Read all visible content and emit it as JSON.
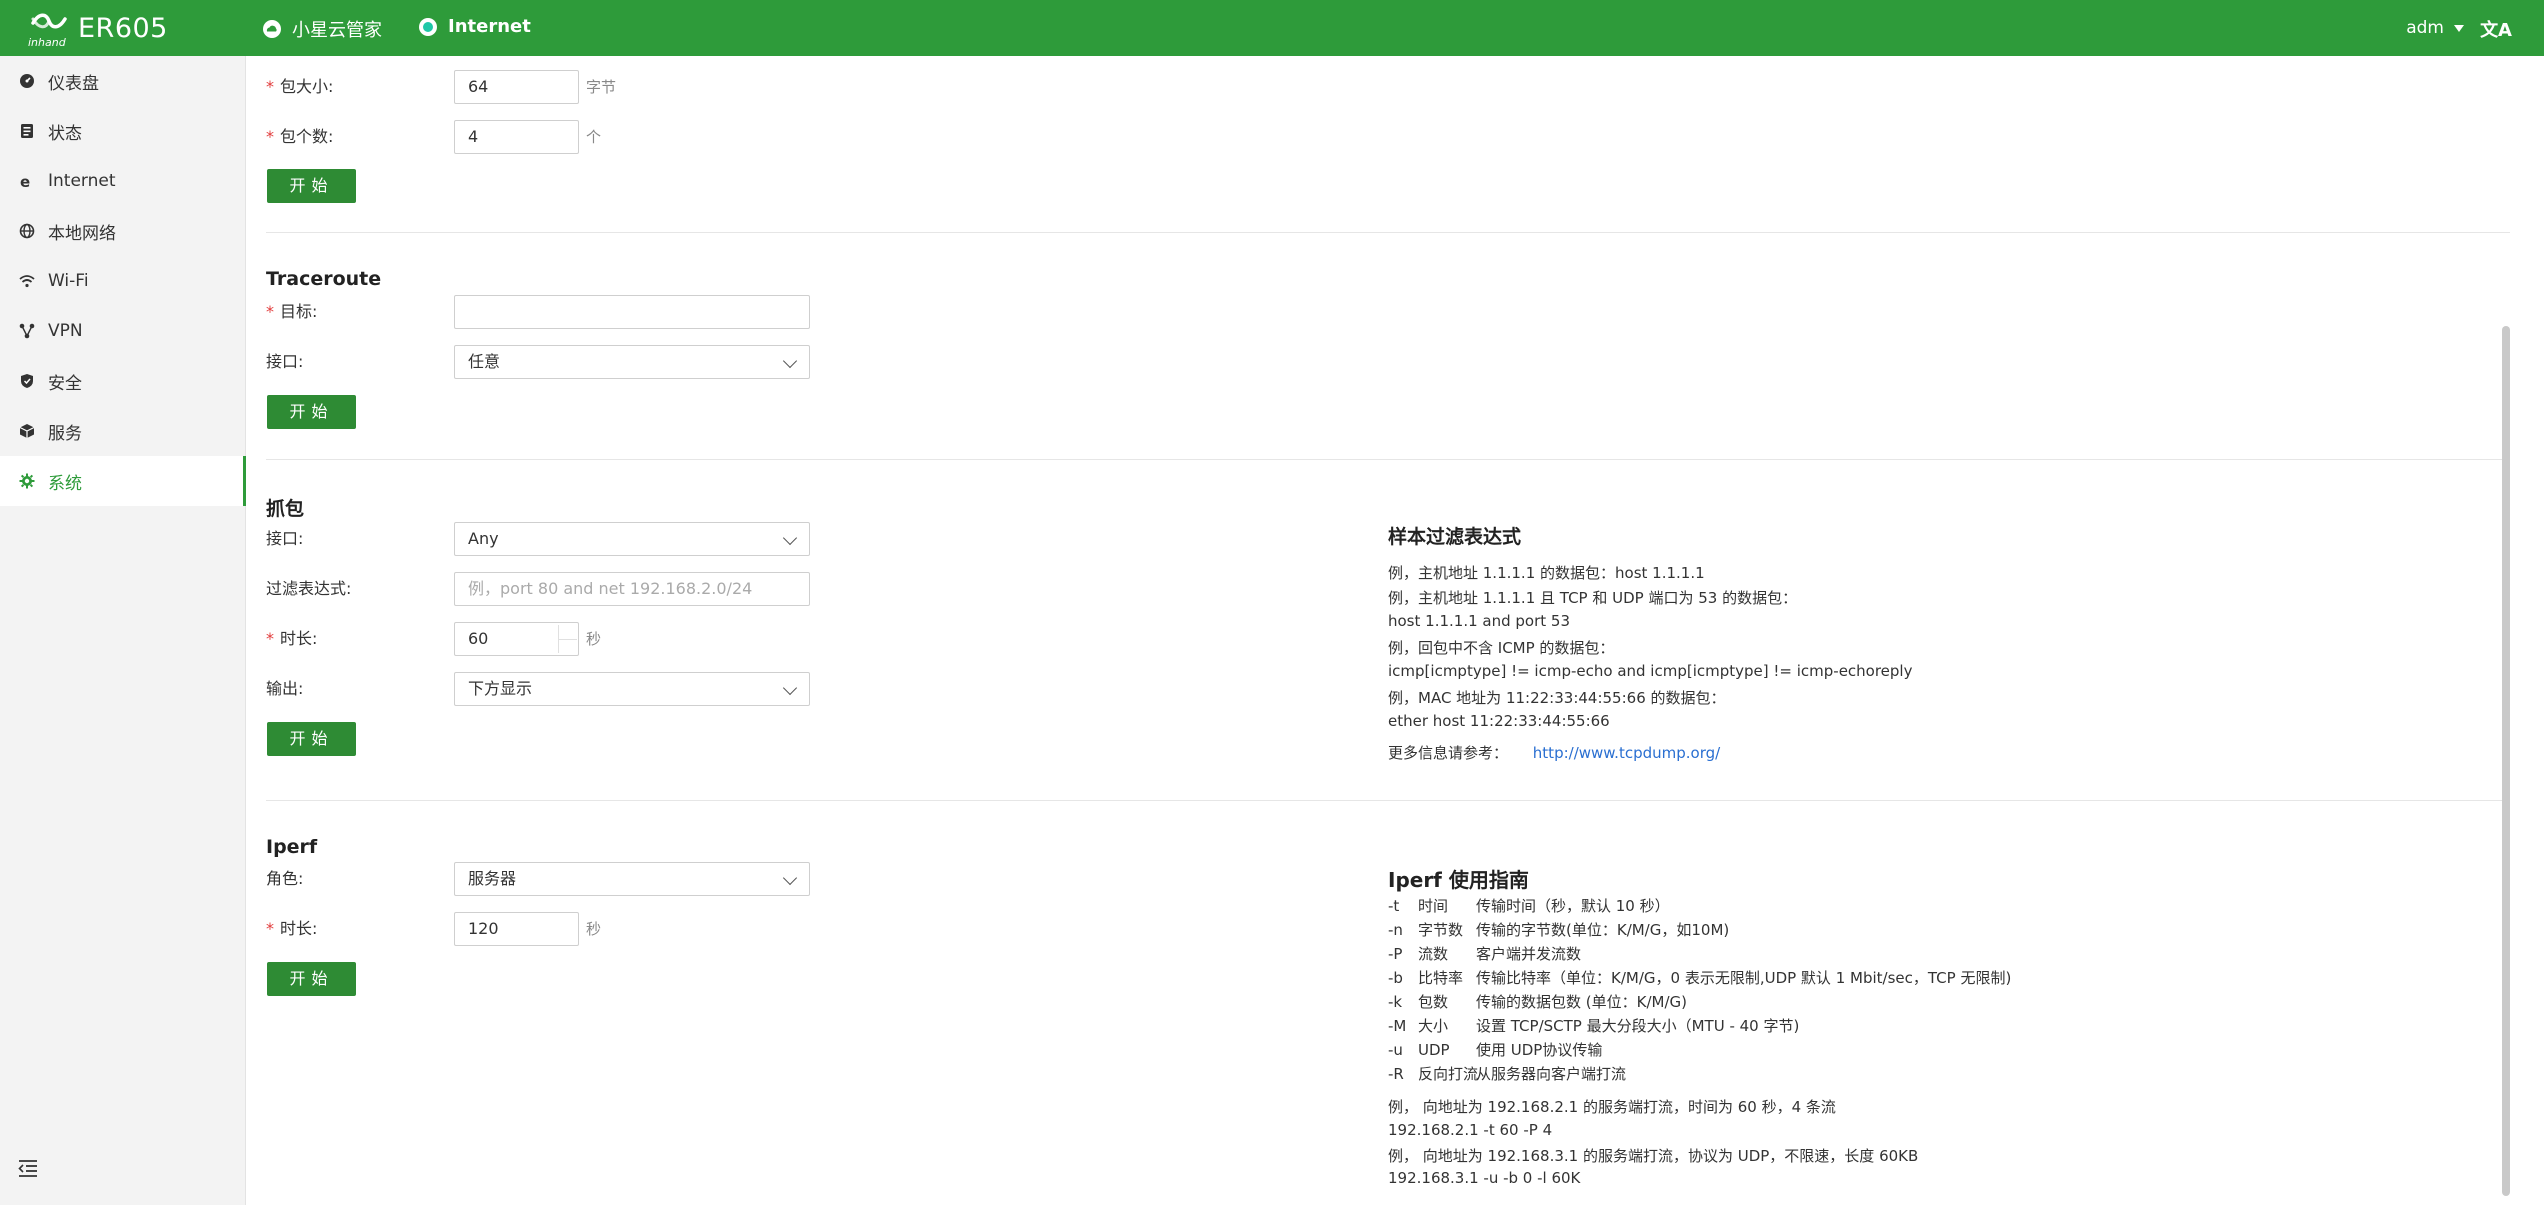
{
  "header": {
    "logo_sub": "inhand",
    "product": "ER605",
    "cloud_link": "小星云管家",
    "internet_link": "Internet",
    "user": "adm",
    "lang_icon": "文A"
  },
  "sidebar": {
    "items": [
      {
        "label": "仪表盘",
        "icon": "dashboard-icon"
      },
      {
        "label": "状态",
        "icon": "status-icon"
      },
      {
        "label": "Internet",
        "icon": "internet-icon"
      },
      {
        "label": "本地网络",
        "icon": "globe-icon"
      },
      {
        "label": "Wi-Fi",
        "icon": "wifi-icon"
      },
      {
        "label": "VPN",
        "icon": "vpn-icon"
      },
      {
        "label": "安全",
        "icon": "shield-icon"
      },
      {
        "label": "服务",
        "icon": "cube-icon"
      },
      {
        "label": "系统",
        "icon": "gear-icon"
      }
    ],
    "active_index": 8
  },
  "ping": {
    "size_label": "包大小:",
    "size_value": "64",
    "size_unit": "字节",
    "count_label": "包个数:",
    "count_value": "4",
    "count_unit": "个",
    "start": "开始"
  },
  "traceroute": {
    "title": "Traceroute",
    "target_label": "目标:",
    "target_value": "",
    "iface_label": "接口:",
    "iface_value": "任意",
    "start": "开始"
  },
  "capture": {
    "title": "抓包",
    "iface_label": "接口:",
    "iface_value": "Any",
    "filter_label": "过滤表达式:",
    "filter_placeholder": "例，port 80 and net 192.168.2.0/24",
    "duration_label": "时长:",
    "duration_value": "60",
    "duration_unit": "秒",
    "output_label": "输出:",
    "output_value": "下方显示",
    "start": "开始",
    "help_title": "样本过滤表达式",
    "help_lines": [
      "例，主机地址 1.1.1.1 的数据包：host 1.1.1.1",
      "例，主机地址 1.1.1.1 且 TCP 和 UDP 端口为 53 的数据包：",
      "host 1.1.1.1 and port 53",
      "例，回包中不含 ICMP 的数据包：",
      "icmp[icmptype] != icmp-echo and icmp[icmptype] != icmp-echoreply",
      "例，MAC 地址为 11:22:33:44:55:66 的数据包：",
      "ether host 11:22:33:44:55:66"
    ],
    "more_label": "更多信息请参考：",
    "more_link": "http://www.tcpdump.org/"
  },
  "iperf": {
    "title": "Iperf",
    "role_label": "角色:",
    "role_value": "服务器",
    "duration_label": "时长:",
    "duration_value": "120",
    "duration_unit": "秒",
    "start": "开始",
    "help_title": "Iperf 使用指南",
    "options": [
      {
        "flag": "-t",
        "name": "时间",
        "desc": "传输时间（秒，默认 10 秒）"
      },
      {
        "flag": "-n",
        "name": "字节数",
        "desc": "传输的字节数(单位：K/M/G，如10M)"
      },
      {
        "flag": "-P",
        "name": "流数",
        "desc": "客户端并发流数"
      },
      {
        "flag": "-b",
        "name": "比特率",
        "desc": "传输比特率（单位：K/M/G，0 表示无限制,UDP 默认 1 Mbit/sec，TCP 无限制)"
      },
      {
        "flag": "-k",
        "name": "包数",
        "desc": "传输的数据包数 (单位：K/M/G)"
      },
      {
        "flag": "-M",
        "name": "大小",
        "desc": "设置 TCP/SCTP 最大分段大小（MTU - 40 字节)"
      },
      {
        "flag": "-u",
        "name": "UDP",
        "desc": "使用 UDP协议传输"
      },
      {
        "flag": "-R",
        "name": "反向打流",
        "desc": "从服务器向客户端打流"
      }
    ],
    "examples": [
      "例， 向地址为 192.168.2.1 的服务端打流，时间为 60 秒，4 条流",
      "192.168.2.1 -t 60 -P 4",
      "例， 向地址为 192.168.3.1 的服务端打流，协议为 UDP，不限速，长度 60KB",
      "192.168.3.1 -u -b 0 -l 60K"
    ]
  }
}
